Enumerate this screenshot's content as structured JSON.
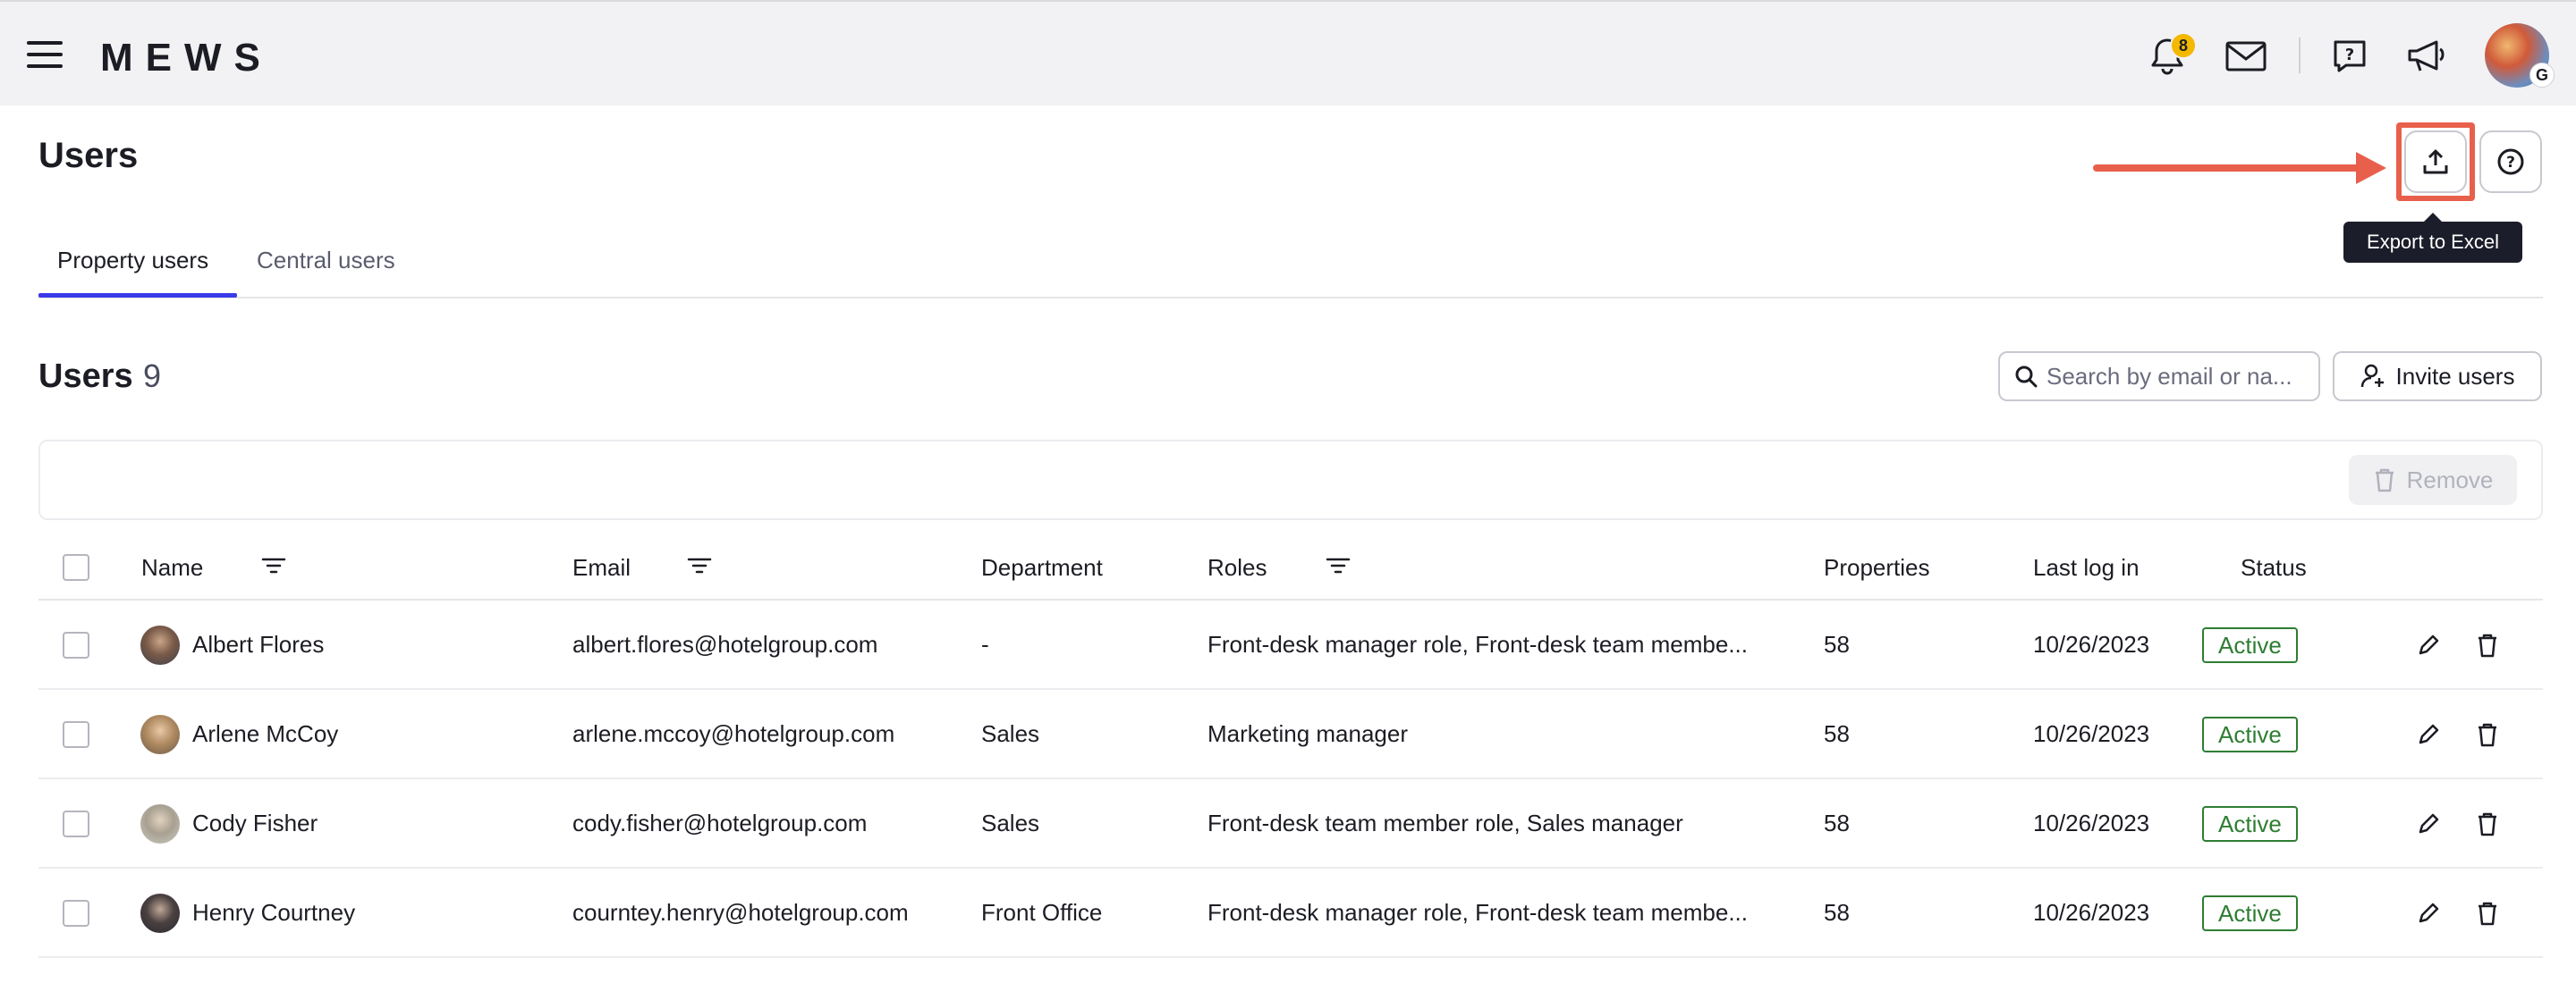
{
  "topbar": {
    "logo": "MEWS",
    "notification_count": "8",
    "avatar_initial": "G",
    "icons": [
      "menu-icon",
      "bell-icon",
      "mail-icon",
      "help-chat-icon",
      "megaphone-icon"
    ]
  },
  "page": {
    "title": "Users",
    "tooltip": "Export to Excel"
  },
  "tabs": [
    {
      "label": "Property users",
      "active": true
    },
    {
      "label": "Central users",
      "active": false
    }
  ],
  "section": {
    "title": "Users",
    "count": "9",
    "search_placeholder": "Search by email or na...",
    "invite_label": "Invite users",
    "remove_label": "Remove"
  },
  "table": {
    "columns": {
      "name": "Name",
      "email": "Email",
      "department": "Department",
      "roles": "Roles",
      "properties": "Properties",
      "last_login": "Last log in",
      "status": "Status"
    },
    "rows": [
      {
        "name": "Albert Flores",
        "email": "albert.flores@hotelgroup.com",
        "department": "-",
        "roles": "Front-desk manager role, Front-desk team membe...",
        "properties": "58",
        "last_login": "10/26/2023",
        "status": "Active"
      },
      {
        "name": "Arlene McCoy",
        "email": "arlene.mccoy@hotelgroup.com",
        "department": "Sales",
        "roles": "Marketing manager",
        "properties": "58",
        "last_login": "10/26/2023",
        "status": "Active"
      },
      {
        "name": "Cody Fisher",
        "email": "cody.fisher@hotelgroup.com",
        "department": "Sales",
        "roles": "Front-desk team member role, Sales manager",
        "properties": "58",
        "last_login": "10/26/2023",
        "status": "Active"
      },
      {
        "name": "Henry Courtney",
        "email": "courntey.henry@hotelgroup.com",
        "department": "Front Office",
        "roles": "Front-desk manager role, Front-desk team membe...",
        "properties": "58",
        "last_login": "10/26/2023",
        "status": "Active"
      }
    ]
  },
  "colors": {
    "accent": "#3a3ae8",
    "highlight": "#e8604c",
    "status_active": "#2e7d32",
    "badge": "#f5b800"
  }
}
